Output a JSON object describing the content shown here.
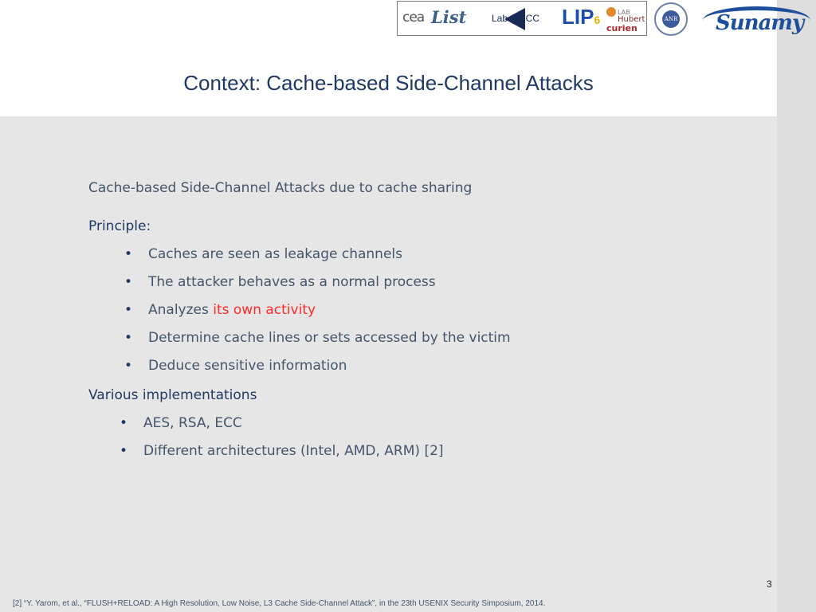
{
  "header": {
    "logos": {
      "cea": "cea",
      "list": "List",
      "labsticc": "Lab-STICC",
      "lip6_main": "LIP",
      "lip6_six": "6",
      "curien_line1": "LAB",
      "curien_line2": "Hubert",
      "curien_line3": "curien",
      "anr": "ANR",
      "sunamy": "Sunamy"
    }
  },
  "slide": {
    "title": "Context: Cache-based Side-Channel Attacks",
    "intro": "Cache-based Side-Channel Attacks due to cache sharing",
    "principle_heading": "Principle:",
    "principle_bullets": [
      {
        "text": "Caches are seen as leakage channels"
      },
      {
        "text": "The attacker behaves as a normal process"
      },
      {
        "text_before": "Analyzes ",
        "text_highlight": "its own activity"
      },
      {
        "text": "Determine cache lines or sets accessed by the victim"
      },
      {
        "text": "Deduce sensitive information"
      }
    ],
    "implementations_heading": "Various implementations",
    "implementation_bullets": [
      {
        "text": "AES, RSA, ECC"
      },
      {
        "text": "Different architectures (Intel, AMD, ARM) [2]"
      }
    ],
    "bullet_char": "•",
    "page_number": "3",
    "footnote": "[2] “Y. Yarom, et al., “FLUSH+RELOAD: A High Resolution, Low Noise, L3 Cache Side-Channel Attack”, in the 23th USENIX Security Simposium, 2014."
  },
  "colors": {
    "title": "#1f3864",
    "body": "#44546a",
    "highlight": "#ff2a2a",
    "background": "#e6e6e6"
  }
}
